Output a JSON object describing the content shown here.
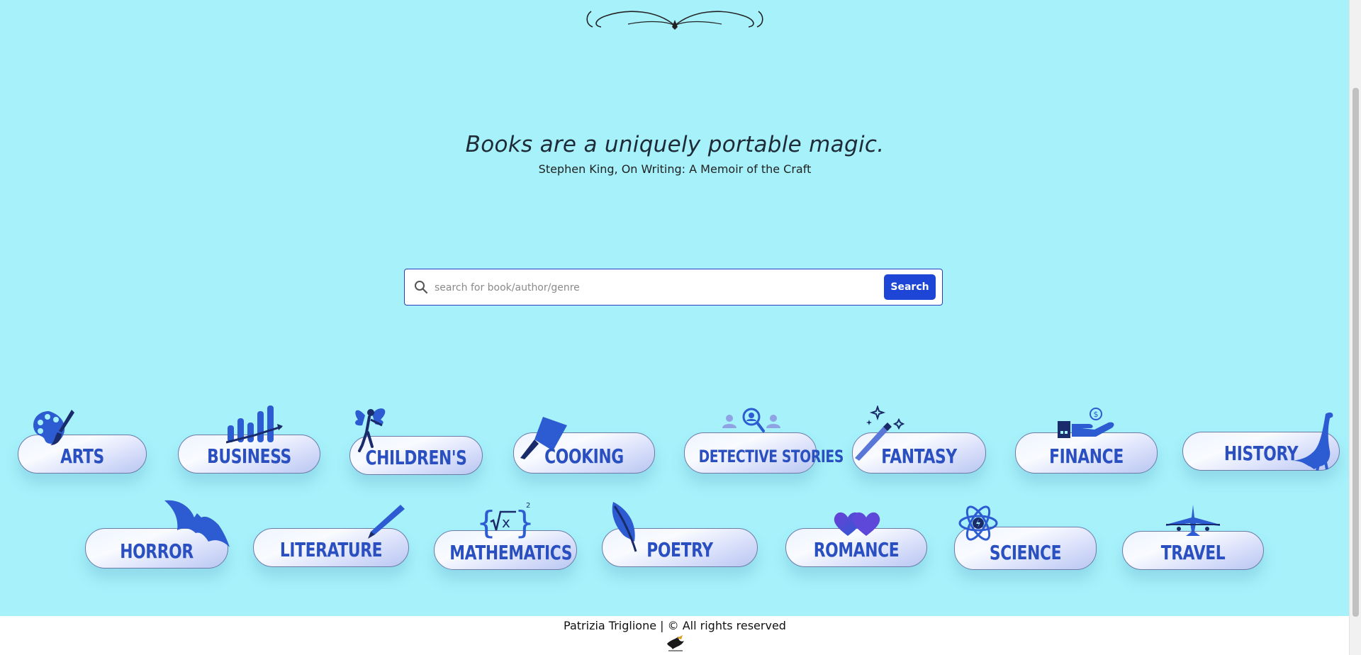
{
  "hero": {
    "quote": "Books are a uniquely portable magic.",
    "attribution": "Stephen King, On Writing: A Memoir of the Craft"
  },
  "search": {
    "placeholder": "search for book/author/genre",
    "button_label": "Search"
  },
  "categories": [
    {
      "label": "ARTS",
      "icon": "palette-icon"
    },
    {
      "label": "BUSINESS",
      "icon": "bar-chart-icon"
    },
    {
      "label": "CHILDREN'S",
      "icon": "fairy-icon"
    },
    {
      "label": "COOKING",
      "icon": "cleaver-icon"
    },
    {
      "label": "DETECTIVE STORIES",
      "icon": "magnifier-people-icon"
    },
    {
      "label": "FANTASY",
      "icon": "magic-wand-icon"
    },
    {
      "label": "FINANCE",
      "icon": "hand-coin-icon"
    },
    {
      "label": "HISTORY",
      "icon": "dinosaur-icon"
    },
    {
      "label": "HORROR",
      "icon": "bat-icon"
    },
    {
      "label": "LITERATURE",
      "icon": "pen-icon"
    },
    {
      "label": "MATHEMATICS",
      "icon": "formula-icon"
    },
    {
      "label": "POETRY",
      "icon": "quill-icon"
    },
    {
      "label": "ROMANCE",
      "icon": "hearts-icon"
    },
    {
      "label": "SCIENCE",
      "icon": "atom-icon"
    },
    {
      "label": "TRAVEL",
      "icon": "airplane-icon"
    }
  ],
  "footer": {
    "text": "Patrizia Triglione | © All rights reserved",
    "logo": "eagle-logo-icon"
  },
  "colors": {
    "background": "#a6f1fa",
    "accent": "#1e46d6",
    "category_text": "#2a4fc0",
    "icon_blue": "#2d5bd1"
  }
}
